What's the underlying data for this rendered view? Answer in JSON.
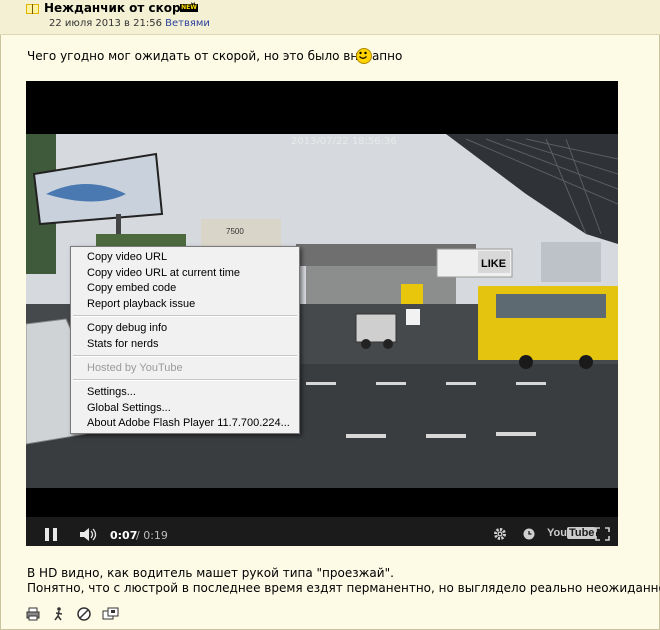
{
  "post": {
    "title": "Нежданчик от скорой",
    "badge": "NEW",
    "date": "22 июля 2013 в 21:56",
    "author": "Ветвями",
    "intro": "Чего угодно мог ожидать от скорой, но это было внезапно",
    "line1": "В HD видно, как водитель машет рукой типа \"проезжай\".",
    "line2": "Понятно, что с люстрой в последнее время ездят перманентно, но выглядело реально неожиданно."
  },
  "video": {
    "timestamp": "2013/07/22  18:56:36",
    "current_time": "0:07",
    "duration": "/ 0:19",
    "progress": 0.37,
    "brand": "YouTube"
  },
  "context_menu": {
    "group1": [
      "Copy video URL",
      "Copy video URL at current time",
      "Copy embed code",
      "Report playback issue"
    ],
    "group2": [
      "Copy debug info",
      "Stats for nerds"
    ],
    "hosted": "Hosted by YouTube",
    "group3": [
      "Settings...",
      "Global Settings...",
      "About Adobe Flash Player 11.7.700.224..."
    ]
  },
  "scene_text": {
    "billboard_price": "7500",
    "billboard_like": "LIKE"
  },
  "toolbar_icons": [
    "print-icon",
    "walk-icon",
    "no-entry-icon",
    "share-icon"
  ]
}
